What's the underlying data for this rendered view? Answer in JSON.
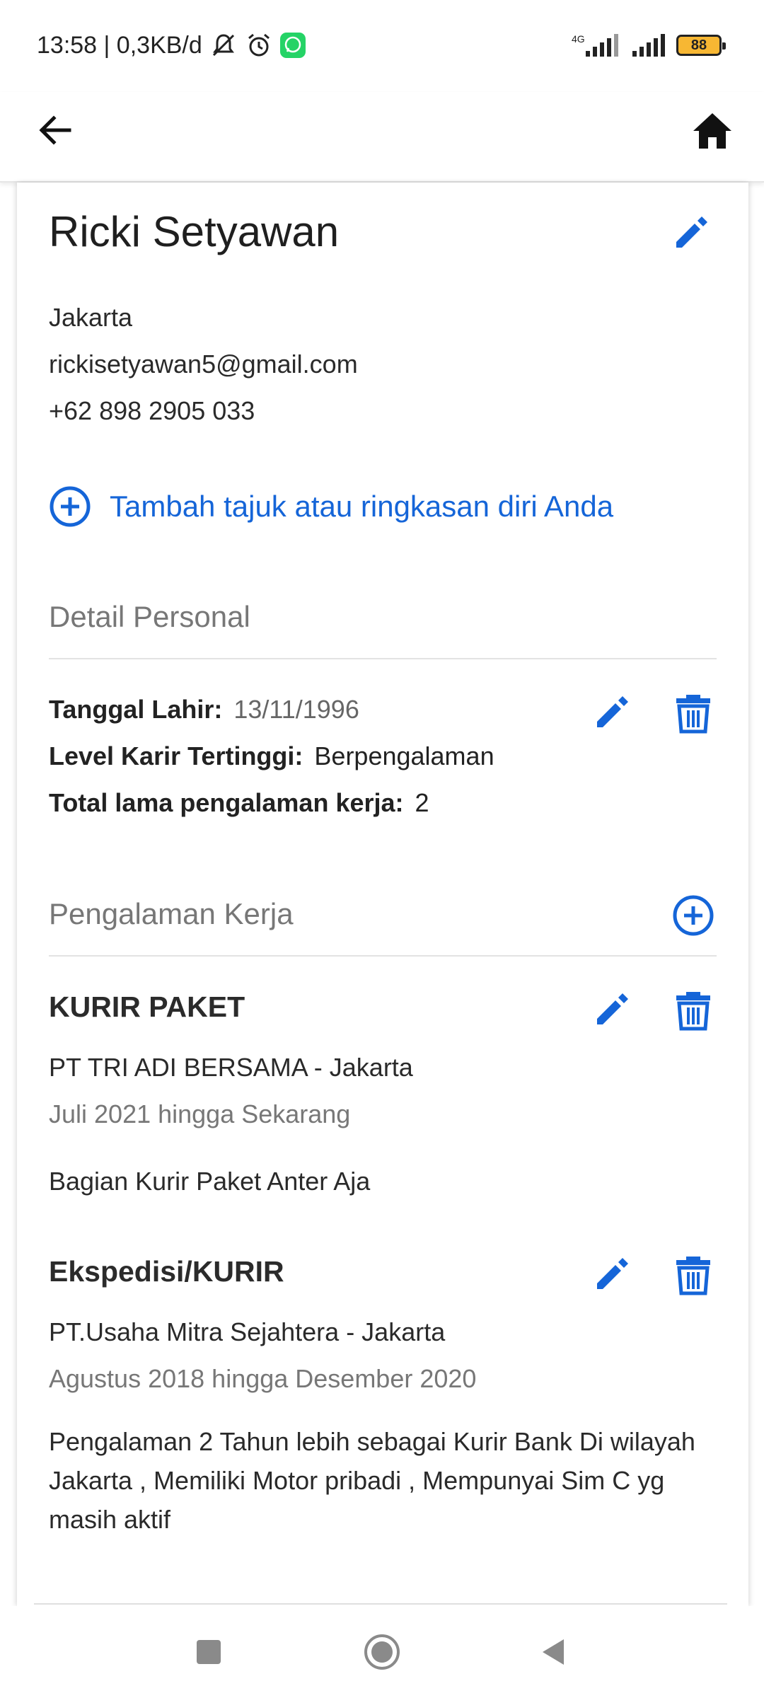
{
  "status": {
    "time_speed": "13:58 | 0,3KB/d",
    "network": "4G",
    "battery": "88"
  },
  "profile": {
    "name": "Ricki Setyawan",
    "city": "Jakarta",
    "email": "rickisetyawan5@gmail.com",
    "phone": "+62 898 2905 033",
    "add_summary": "Tambah tajuk atau ringkasan diri Anda"
  },
  "personal": {
    "title": "Detail Personal",
    "birth_label": "Tanggal Lahir:",
    "birth_value": "13/11/1996",
    "level_label": "Level Karir Tertinggi:",
    "level_value": "Berpengalaman",
    "total_label": "Total lama pengalaman kerja:",
    "total_value": "2"
  },
  "experience": {
    "title": "Pengalaman Kerja",
    "jobs": [
      {
        "title": "KURIR PAKET",
        "company": "PT TRI ADI BERSAMA - Jakarta",
        "period": "Juli 2021 hingga Sekarang",
        "desc": "Bagian Kurir Paket Anter Aja"
      },
      {
        "title": "Ekspedisi/KURIR",
        "company": "PT.Usaha Mitra Sejahtera - Jakarta",
        "period": "Agustus 2018 hingga Desember 2020",
        "desc": "Pengalaman 2 Tahun lebih sebagai Kurir Bank Di wilayah Jakarta , Memiliki Motor pribadi , Mempunyai Sim C yg masih aktif"
      }
    ]
  },
  "colors": {
    "accent": "#1565d8"
  }
}
